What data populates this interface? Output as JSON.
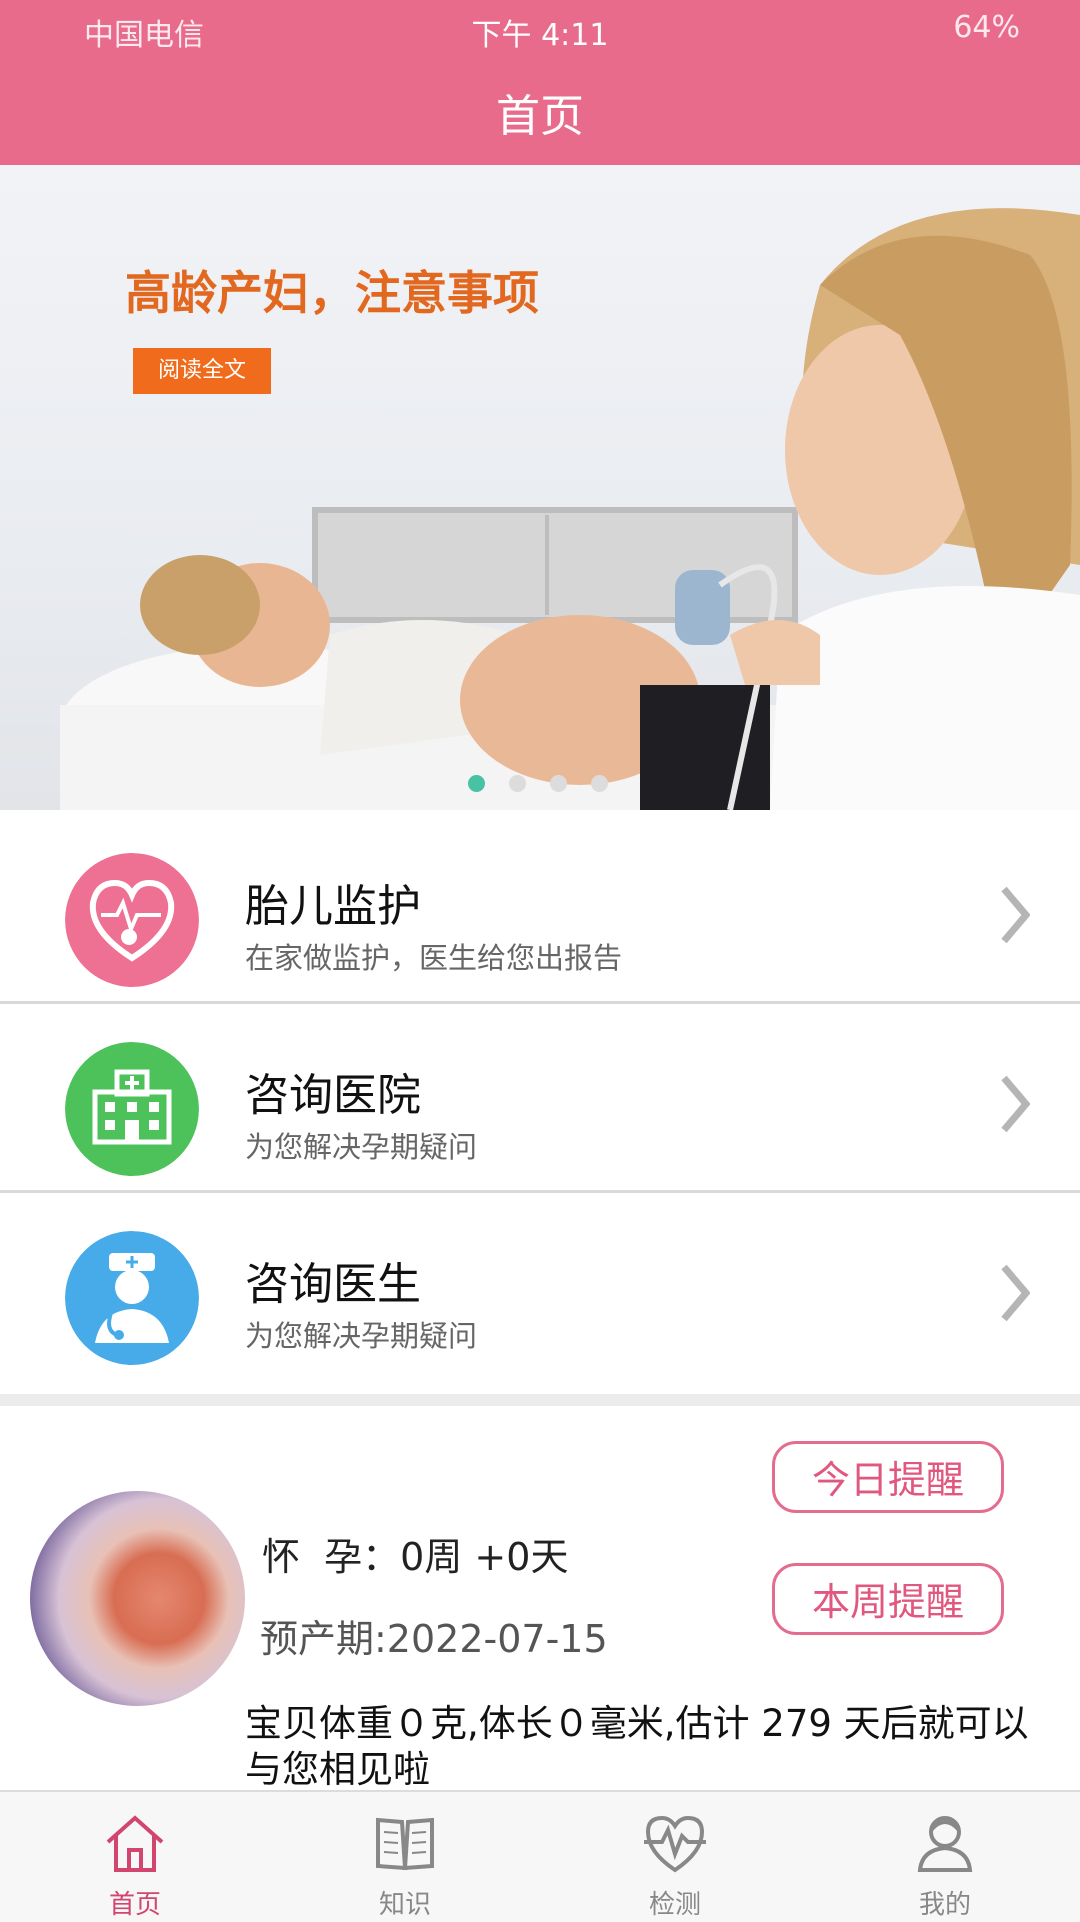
{
  "status_bar": {
    "carrier": "中国电信",
    "time": "下午 4:11",
    "battery": "64%"
  },
  "header": {
    "title": "首页"
  },
  "banner": {
    "headline": "高龄产妇，注意事项",
    "read_button": "阅读全文",
    "slide_count": 4,
    "active_slide": 1
  },
  "menu": [
    {
      "title": "胎儿监护",
      "subtitle": "在家做监护，医生给您出报告",
      "icon": "fetal-heart-icon",
      "color": "#ee7093"
    },
    {
      "title": "咨询医院",
      "subtitle": "为您解决孕期疑问",
      "icon": "hospital-icon",
      "color": "#4dc25a"
    },
    {
      "title": "咨询医生",
      "subtitle": "为您解决孕期疑问",
      "icon": "doctor-icon",
      "color": "#47abe9"
    }
  ],
  "pregnancy": {
    "label": "怀  孕：",
    "weeks_days": "0周 +0天",
    "due_date": "预产期:2022-07-15",
    "today_button": "今日提醒",
    "week_button": "本周提醒",
    "message": "宝贝体重０克,体长０毫米,估计 279 天后就可以与您相见啦"
  },
  "tabs": [
    {
      "label": "首页",
      "icon": "home-icon",
      "active": true
    },
    {
      "label": "知识",
      "icon": "book-icon",
      "active": false
    },
    {
      "label": "检测",
      "icon": "heart-monitor-icon",
      "active": false
    },
    {
      "label": "我的",
      "icon": "user-icon",
      "active": false
    }
  ],
  "colors": {
    "brand": "#e96b8b",
    "accent": "#e0577f",
    "active_dot": "#48c1a5"
  }
}
